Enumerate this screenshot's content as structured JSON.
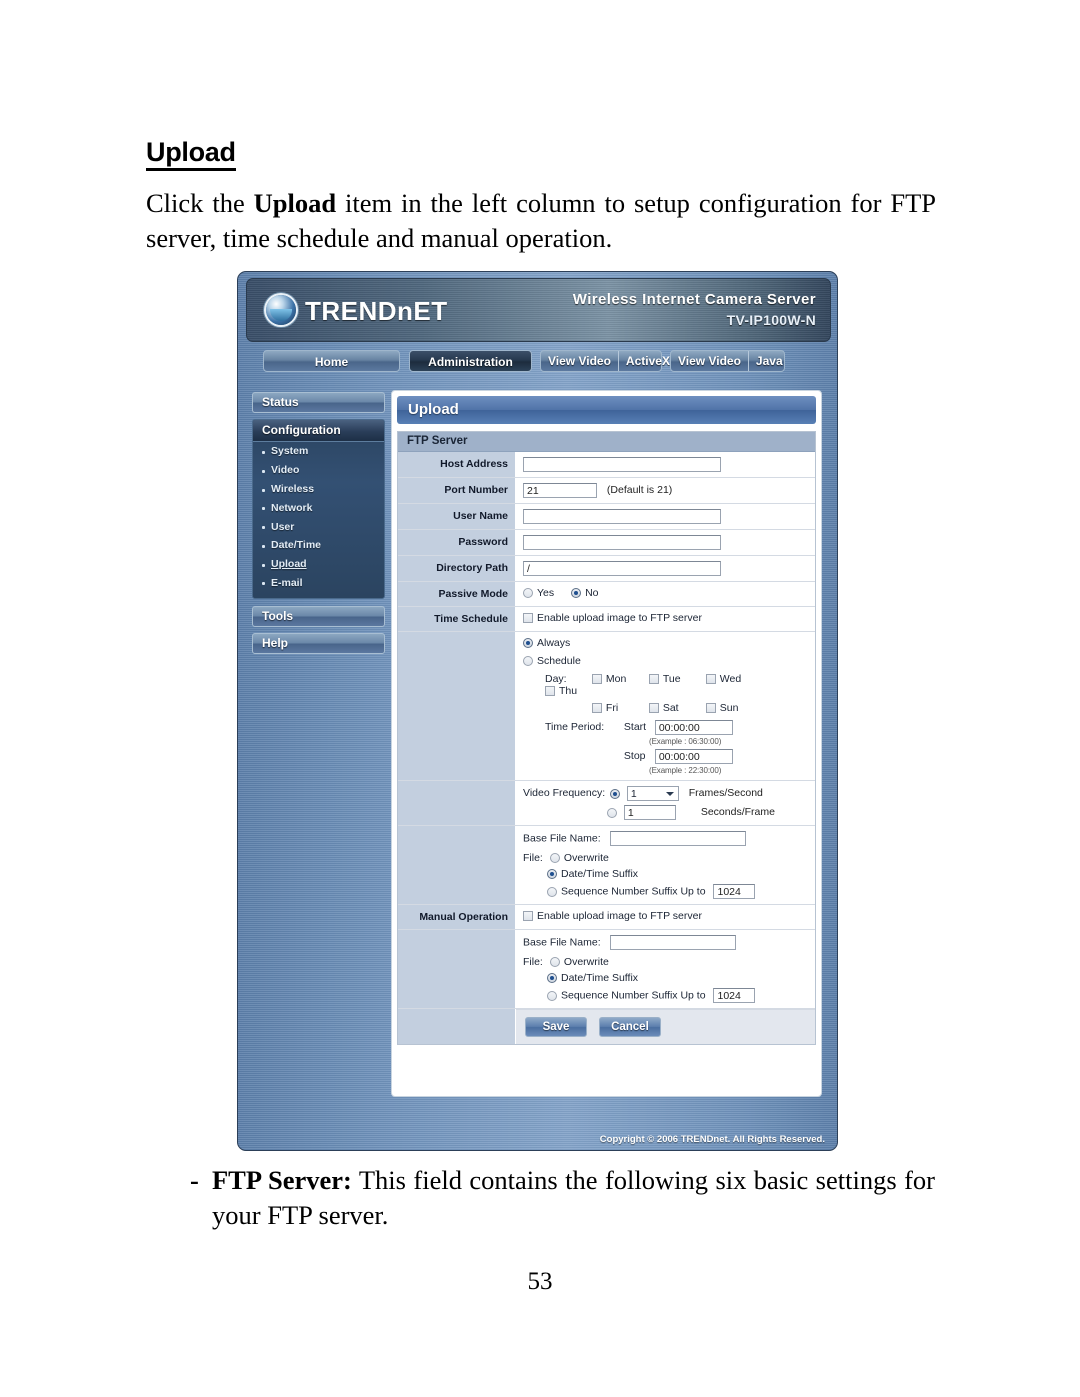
{
  "document": {
    "heading": "Upload",
    "paragraph_parts": [
      "Click the ",
      "Upload",
      " item in the left column to setup configuration for FTP server, time schedule and manual operation."
    ],
    "bullet_dash": "-",
    "bullet_bold": "FTP Server:",
    "bullet_text": " This field contains the following six basic settings for your FTP server.",
    "page_number": "53"
  },
  "camera_ui": {
    "brand": "TRENDnET",
    "product_title": "Wireless Internet Camera Server",
    "product_model": "TV-IP100W-N",
    "tabs": [
      {
        "label": "Home",
        "active": false
      },
      {
        "label": "Administration",
        "active": true
      },
      {
        "label": "View Video",
        "label2": "ActiveX",
        "active": false
      },
      {
        "label": "View Video",
        "label2": "Java",
        "active": false
      }
    ],
    "sidebar": {
      "status_label": "Status",
      "configuration_label": "Configuration",
      "config_items": [
        "System",
        "Video",
        "Wireless",
        "Network",
        "User",
        "Date/Time",
        "Upload",
        "E-mail"
      ],
      "current_item": "Upload",
      "tools_label": "Tools",
      "help_label": "Help"
    },
    "page_title": "Upload",
    "ftp_server": {
      "section_label": "FTP Server",
      "host_address_label": "Host Address",
      "host_address_value": "",
      "port_number_label": "Port Number",
      "port_number_value": "21",
      "port_number_hint": "(Default is 21)",
      "user_name_label": "User Name",
      "user_name_value": "",
      "password_label": "Password",
      "password_value": "",
      "directory_path_label": "Directory Path",
      "directory_path_value": "/",
      "passive_mode_label": "Passive Mode",
      "passive_yes": "Yes",
      "passive_no": "No",
      "passive_selected": "No"
    },
    "time_schedule": {
      "label": "Time Schedule",
      "enable_label": "Enable upload image to FTP server",
      "enable_checked": false,
      "always_label": "Always",
      "schedule_label": "Schedule",
      "mode_selected": "Always",
      "day_label": "Day:",
      "days": [
        "Mon",
        "Tue",
        "Wed",
        "Thu",
        "Fri",
        "Sat",
        "Sun"
      ],
      "days_checked": [],
      "time_period_label": "Time Period:",
      "start_label": "Start",
      "start_value": "00:00:00",
      "start_example": "(Example : 06:30:00)",
      "stop_label": "Stop",
      "stop_value": "00:00:00",
      "stop_example": "(Example : 22:30:00)",
      "video_frequency_label": "Video Frequency:",
      "frames_per_second_value": "1",
      "frames_per_second_label": "Frames/Second",
      "seconds_per_frame_value": "1",
      "seconds_per_frame_label": "Seconds/Frame",
      "frequency_selected": "Frames/Second",
      "base_file_name_label": "Base File Name:",
      "base_file_name_value": "",
      "file_label": "File:",
      "file_overwrite": "Overwrite",
      "file_datetime": "Date/Time Suffix",
      "file_sequence": "Sequence Number Suffix Up to",
      "file_sequence_value": "1024",
      "file_selected": "Date/Time Suffix"
    },
    "manual_operation": {
      "label": "Manual Operation",
      "enable_label": "Enable upload image to FTP server",
      "enable_checked": false,
      "base_file_name_label": "Base File Name:",
      "base_file_name_value": "",
      "file_label": "File:",
      "file_overwrite": "Overwrite",
      "file_datetime": "Date/Time Suffix",
      "file_sequence": "Sequence Number Suffix Up to",
      "file_sequence_value": "1024",
      "file_selected": "Date/Time Suffix"
    },
    "buttons": {
      "save": "Save",
      "cancel": "Cancel"
    },
    "copyright": "Copyright © 2006 TRENDnet. All Rights Reserved."
  }
}
